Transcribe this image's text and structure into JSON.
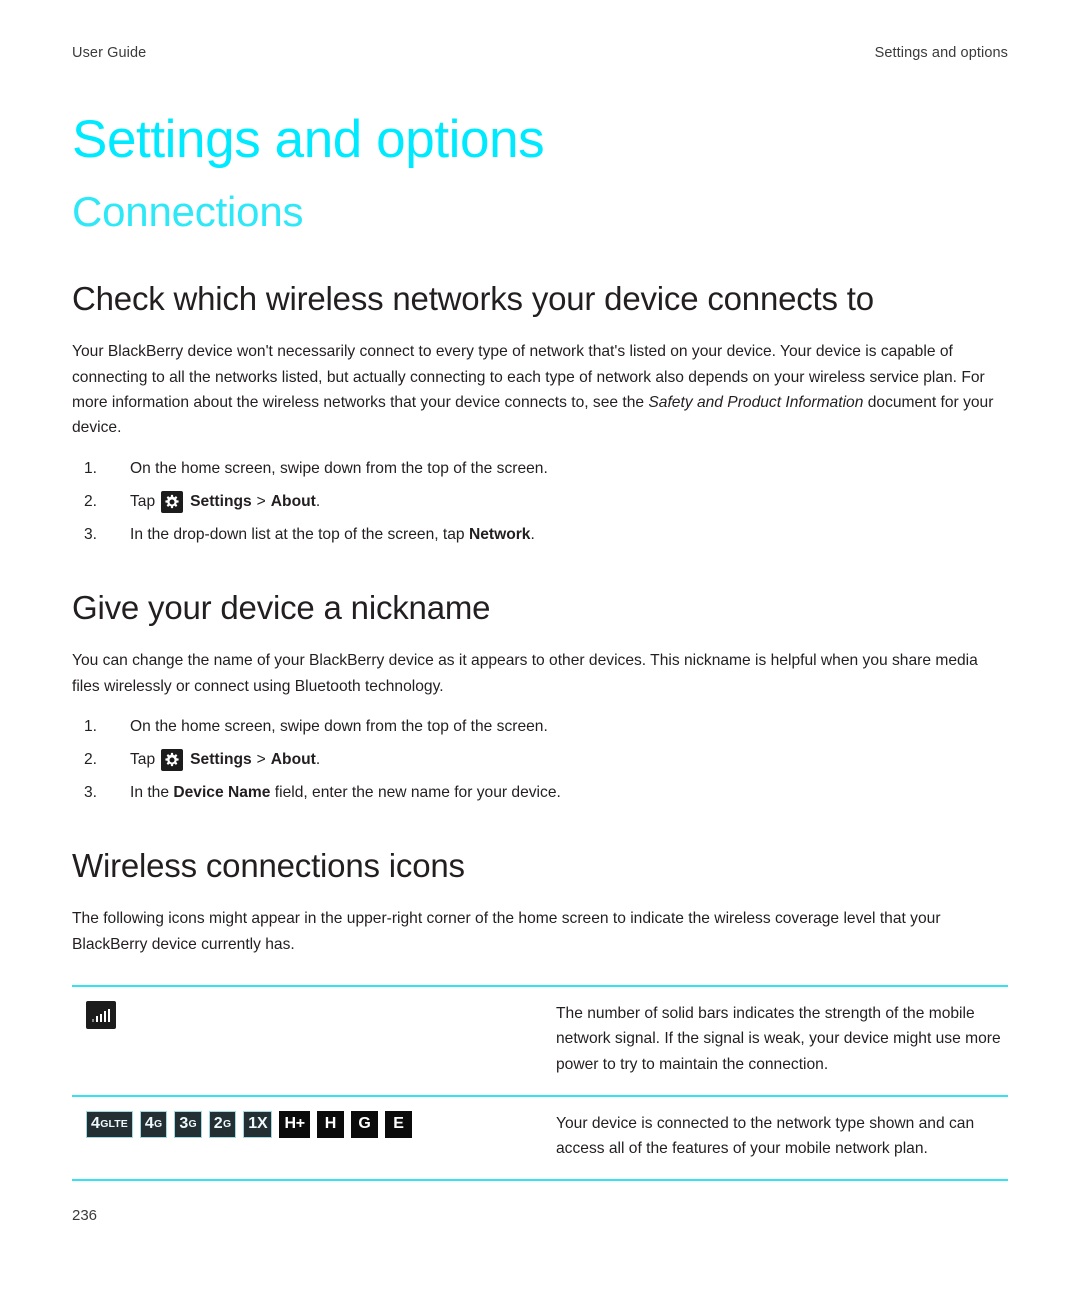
{
  "header": {
    "left": "User Guide",
    "right": "Settings and options"
  },
  "doc_title": "Settings and options",
  "chapter_title": "Connections",
  "sections": [
    {
      "heading": "Check which wireless networks your device connects to",
      "paragraph_part1": "Your BlackBerry device won't necessarily connect to every type of network that's listed on your device. Your device is capable of connecting to all the networks listed, but actually connecting to each type of network also depends on your wireless service plan. For more information about the wireless networks that your device connects to, see the ",
      "paragraph_italic": "Safety and Product Information",
      "paragraph_part2": " document for your device.",
      "steps": [
        {
          "num": "1.",
          "text": "On the home screen, swipe down from the top of the screen."
        },
        {
          "num": "2.",
          "pre": "Tap",
          "bold1": "Settings",
          "sep": ">",
          "bold2": "About",
          "post": "."
        },
        {
          "num": "3.",
          "pre": "In the drop-down list at the top of the screen, tap ",
          "bold": "Network",
          "post": "."
        }
      ]
    },
    {
      "heading": "Give your device a nickname",
      "paragraph": "You can change the name of your BlackBerry device as it appears to other devices. This nickname is helpful when you share media files wirelessly or connect using Bluetooth technology.",
      "steps": [
        {
          "num": "1.",
          "text": "On the home screen, swipe down from the top of the screen."
        },
        {
          "num": "2.",
          "pre": "Tap",
          "bold1": "Settings",
          "sep": ">",
          "bold2": "About",
          "post": "."
        },
        {
          "num": "3.",
          "pre": "In the ",
          "bold": "Device Name",
          "post": " field, enter the new name for your device."
        }
      ]
    },
    {
      "heading": "Wireless connections icons",
      "paragraph": "The following icons might appear in the upper-right corner of the home screen to indicate the wireless coverage level that your BlackBerry device currently has."
    }
  ],
  "icon_table": {
    "rows": [
      {
        "icon_kind": "signal-bars",
        "icon_name": "signal-bars-icon",
        "description": "The number of solid bars indicates the strength of the mobile network signal. If the signal is weak, your device might use more power to try to maintain the connection."
      },
      {
        "icon_kind": "network-badges",
        "badges": [
          {
            "big": "4",
            "sub": "GLTE",
            "style": "outlined"
          },
          {
            "big": "4",
            "sub": "G",
            "style": "outlined"
          },
          {
            "big": "3",
            "sub": "G",
            "style": "outlined"
          },
          {
            "big": "2",
            "sub": "G",
            "style": "outlined"
          },
          {
            "big": "1X",
            "sub": "",
            "style": "outlined"
          },
          {
            "big": "H+",
            "sub": "",
            "style": "plain"
          },
          {
            "big": "H",
            "sub": "",
            "style": "plain"
          },
          {
            "big": "G",
            "sub": "",
            "style": "plain"
          },
          {
            "big": "E",
            "sub": "",
            "style": "plain"
          }
        ],
        "description": "Your device is connected to the network type shown and can access all of the features of your mobile network plan."
      }
    ]
  },
  "page_number": "236",
  "colors": {
    "accent_cyan": "#00eaff",
    "chapter_cyan": "#2fe8f7",
    "rule_cyan": "#34e3f2",
    "text": "#231f20",
    "chip_dark": "#1c1c1c",
    "badge_dark": "#232f33",
    "badge_black": "#0b0b0b"
  }
}
